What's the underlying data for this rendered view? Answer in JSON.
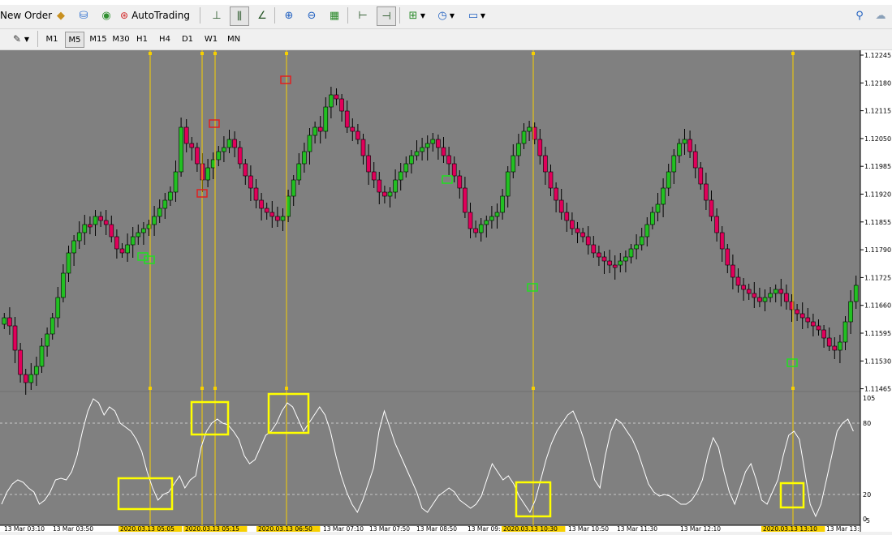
{
  "toolbar": {
    "new_order_label": "New Order",
    "autotrading_label": "AutoTrading",
    "timeframes": [
      "M1",
      "M5",
      "M15",
      "M30",
      "H1",
      "H4",
      "D1",
      "W1",
      "MN"
    ],
    "active_timeframe": "M5"
  },
  "chart": {
    "price_axis_labels": [
      "1.12245",
      "1.12180",
      "1.12115",
      "1.12050",
      "1.11985",
      "1.11920",
      "1.11855",
      "1.11790",
      "1.11725",
      "1.11660",
      "1.11595",
      "1.11530",
      "1.11465"
    ],
    "indicator_axis_labels": [
      "105",
      "80",
      "20",
      "0"
    ],
    "indicator_axis_extra": "-5",
    "time_labels": [
      "13 Mar 03:10",
      "13 Mar 03:50",
      "2020.03.13 05:05",
      "2020.03.13 05:15",
      "2020.03.13 06:50",
      "13 Mar 07:10",
      "13 Mar 07:50",
      "13 Mar 08:50",
      "13 Mar 09:",
      "2020.03.13 10:30",
      "13 Mar 10:50",
      "13 Mar 11:30",
      "13 Mar 12:10",
      "2020.03.13 13:10",
      "13 Mar 13:"
    ],
    "colors": {
      "background": "#808080",
      "bull": "#22c022",
      "bear": "#e0005a",
      "wick": "#000000",
      "marker_line": "#f7d000",
      "highlight_box": "#ffff00",
      "indicator_line": "#ffffff"
    }
  }
}
